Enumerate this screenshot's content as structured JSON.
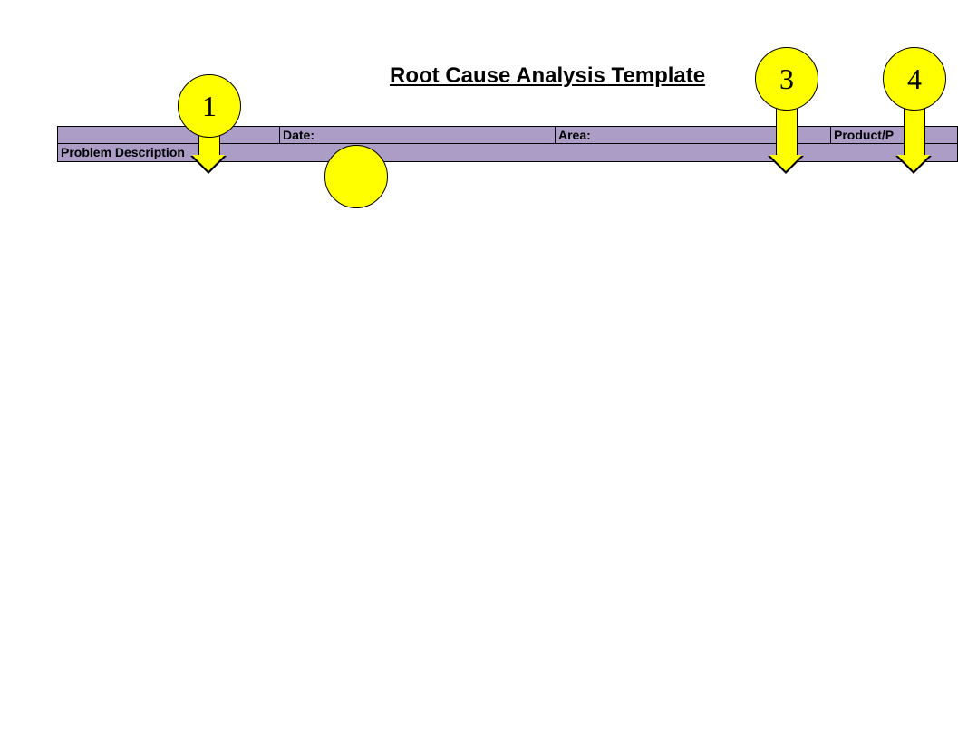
{
  "title": "Root Cause Analysis Template",
  "row1": {
    "date_label": "Date:",
    "area_label": "Area:",
    "product_label": "Product/P"
  },
  "row2": {
    "problem_label": "Problem Description"
  },
  "callouts": {
    "c1": "1",
    "c3": "3",
    "c4": "4"
  }
}
